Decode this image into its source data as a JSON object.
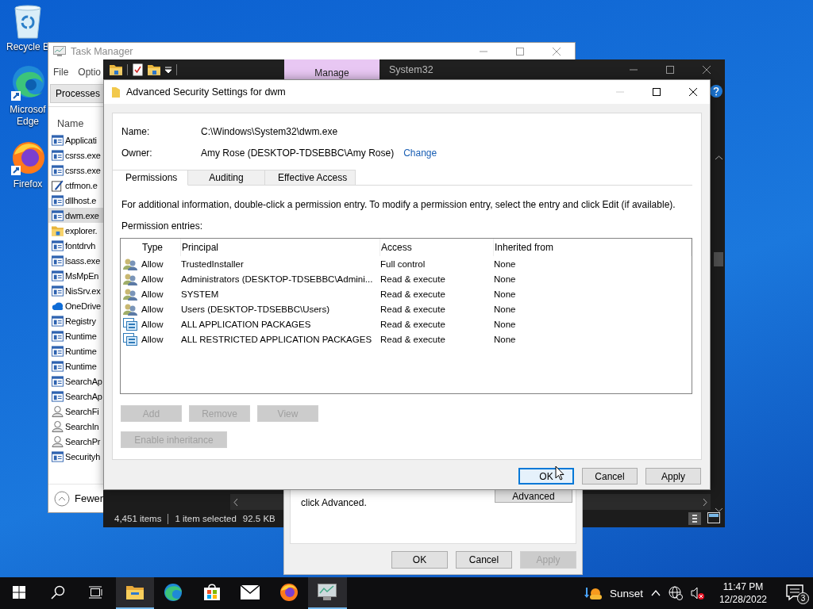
{
  "desktop_icons": [
    {
      "kind": "recycle_bin",
      "label": "Recycle B"
    },
    {
      "kind": "edge",
      "label": "Microsof Edge"
    },
    {
      "kind": "firefox",
      "label": "Firefox"
    }
  ],
  "task_manager": {
    "title": "Task Manager",
    "menu": [
      "File",
      "Optio"
    ],
    "tabs": [
      {
        "label": "Processes",
        "selected": true
      }
    ],
    "column": "Name",
    "processes": [
      {
        "kind": "window",
        "name": "Applicati",
        "selected": false
      },
      {
        "kind": "window",
        "name": "csrss.exe",
        "selected": false
      },
      {
        "kind": "window",
        "name": "csrss.exe",
        "selected": false
      },
      {
        "kind": "pen",
        "name": "ctfmon.e",
        "selected": false
      },
      {
        "kind": "window",
        "name": "dllhost.e",
        "selected": false
      },
      {
        "kind": "window",
        "name": "dwm.exe",
        "selected": true
      },
      {
        "kind": "folder",
        "name": "explorer.",
        "selected": false
      },
      {
        "kind": "window",
        "name": "fontdrvh",
        "selected": false
      },
      {
        "kind": "window",
        "name": "lsass.exe",
        "selected": false
      },
      {
        "kind": "window",
        "name": "MsMpEn",
        "selected": false
      },
      {
        "kind": "window",
        "name": "NisSrv.ex",
        "selected": false
      },
      {
        "kind": "cloud",
        "name": "OneDrive",
        "selected": false
      },
      {
        "kind": "window",
        "name": "Registry",
        "selected": false
      },
      {
        "kind": "window",
        "name": "Runtime",
        "selected": false
      },
      {
        "kind": "window",
        "name": "Runtime",
        "selected": false
      },
      {
        "kind": "window",
        "name": "Runtime",
        "selected": false
      },
      {
        "kind": "window",
        "name": "SearchAp",
        "selected": false
      },
      {
        "kind": "window",
        "name": "SearchAp",
        "selected": false
      },
      {
        "kind": "user",
        "name": "SearchFi",
        "selected": false
      },
      {
        "kind": "user",
        "name": "SearchIn",
        "selected": false
      },
      {
        "kind": "user",
        "name": "SearchPr",
        "selected": false
      },
      {
        "kind": "window",
        "name": "Securityh",
        "selected": false
      }
    ],
    "footer": "Fewer"
  },
  "explorer": {
    "ribbon_tab": "Manage",
    "title": "System32",
    "item_count": "4,451 items",
    "selection": "1 item selected",
    "selection_size": "92.5 KB"
  },
  "properties_dialog": {
    "hint": "click Advanced.",
    "advanced_button": "Advanced",
    "buttons": [
      {
        "label": "OK",
        "disabled": false
      },
      {
        "label": "Cancel",
        "disabled": false
      },
      {
        "label": "Apply",
        "disabled": true
      }
    ]
  },
  "security_dialog": {
    "title": "Advanced Security Settings for dwm",
    "name_label": "Name:",
    "name": "C:\\Windows\\System32\\dwm.exe",
    "owner_label": "Owner:",
    "owner": "Amy Rose (DESKTOP-TDSEBBC\\Amy Rose)",
    "change_link": "Change",
    "tabs": [
      {
        "label": "Permissions",
        "selected": true
      },
      {
        "label": "Auditing",
        "selected": false
      },
      {
        "label": "Effective Access",
        "selected": false
      }
    ],
    "info": "For additional information, double-click a permission entry. To modify a permission entry, select the entry and click Edit (if available).",
    "entries_label": "Permission entries:",
    "columns": [
      "Type",
      "Principal",
      "Access",
      "Inherited from"
    ],
    "entries": [
      {
        "kind": "group",
        "type": "Allow",
        "principal": "TrustedInstaller",
        "access": "Full control",
        "inherited_from": "None"
      },
      {
        "kind": "group",
        "type": "Allow",
        "principal": "Administrators (DESKTOP-TDSEBBC\\Admini...",
        "access": "Read & execute",
        "inherited_from": "None"
      },
      {
        "kind": "group",
        "type": "Allow",
        "principal": "SYSTEM",
        "access": "Read & execute",
        "inherited_from": "None"
      },
      {
        "kind": "group",
        "type": "Allow",
        "principal": "Users (DESKTOP-TDSEBBC\\Users)",
        "access": "Read & execute",
        "inherited_from": "None"
      },
      {
        "kind": "package",
        "type": "Allow",
        "principal": "ALL APPLICATION PACKAGES",
        "access": "Read & execute",
        "inherited_from": "None"
      },
      {
        "kind": "package",
        "type": "Allow",
        "principal": "ALL RESTRICTED APPLICATION PACKAGES",
        "access": "Read & execute",
        "inherited_from": "None"
      }
    ],
    "entry_buttons": [
      {
        "label": "Add",
        "disabled": true
      },
      {
        "label": "Remove",
        "disabled": true
      },
      {
        "label": "View",
        "disabled": true
      }
    ],
    "inheritance_button": {
      "label": "Enable inheritance",
      "disabled": true
    },
    "buttons": [
      {
        "label": "OK",
        "focused": true
      },
      {
        "label": "Cancel",
        "focused": false
      },
      {
        "label": "Apply",
        "focused": false
      }
    ]
  },
  "taskbar": {
    "apps": [
      {
        "kind": "start",
        "active": false
      },
      {
        "kind": "search",
        "active": false
      },
      {
        "kind": "task_view",
        "active": false
      },
      {
        "kind": "explorer",
        "active": true
      },
      {
        "kind": "edge",
        "active": false
      },
      {
        "kind": "store",
        "active": false
      },
      {
        "kind": "mail",
        "active": false
      },
      {
        "kind": "firefox",
        "active": false
      },
      {
        "kind": "task_manager",
        "active": true
      }
    ],
    "weather": "Sunset",
    "time": "11:47 PM",
    "date": "12/28/2022",
    "notifications": "3"
  }
}
